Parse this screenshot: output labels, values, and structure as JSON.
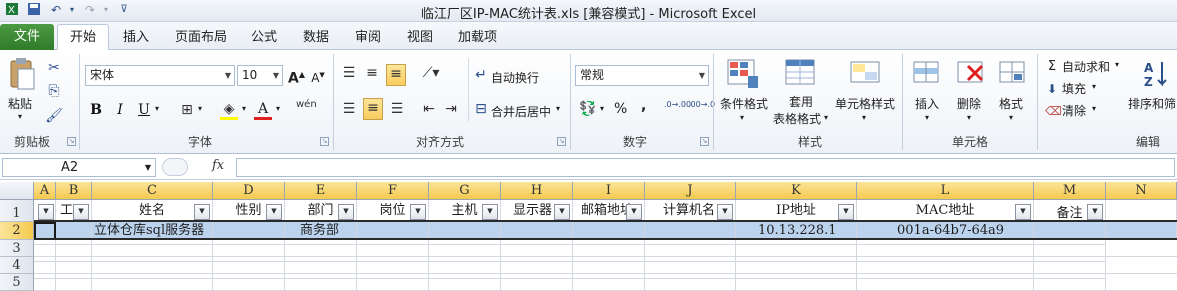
{
  "window": {
    "title": "临江厂区IP-MAC统计表.xls  [兼容模式]  -  Microsoft Excel"
  },
  "quick_access": {
    "save_icon": "save-icon",
    "undo_icon": "undo-icon",
    "redo_icon": "redo-icon",
    "customize_icon": "customize-icon"
  },
  "tabs": {
    "file": "文件",
    "home": "开始",
    "insert": "插入",
    "page_layout": "页面布局",
    "formulas": "公式",
    "data": "数据",
    "review": "审阅",
    "view": "视图",
    "addins": "加载项"
  },
  "ribbon": {
    "clipboard": {
      "paste": "粘贴",
      "group": "剪贴板"
    },
    "font": {
      "name": "宋体",
      "size": "10",
      "bold": "B",
      "italic": "I",
      "underline": "U",
      "phonetic": "wén",
      "group": "字体"
    },
    "alignment": {
      "wrap": "自动换行",
      "merge": "合并后居中",
      "group": "对齐方式"
    },
    "number": {
      "format": "常规",
      "percent": "%",
      "comma": ",",
      "inc_decimal": ".0→.00",
      "dec_decimal": ".00→.0",
      "group": "数字"
    },
    "styles": {
      "conditional": "条件格式",
      "table_line1": "套用",
      "table_line2": "表格格式",
      "cell_styles": "单元格样式",
      "group": "样式"
    },
    "cells": {
      "insert": "插入",
      "delete": "删除",
      "format": "格式",
      "group": "单元格"
    },
    "editing": {
      "autosum": "自动求和",
      "fill": "填充",
      "clear": "清除",
      "sort": "排序和筛",
      "group": "编辑"
    }
  },
  "formula_bar": {
    "name_box": "A2",
    "fx": "fx",
    "content": ""
  },
  "columns": [
    "A",
    "B",
    "C",
    "D",
    "E",
    "F",
    "G",
    "H",
    "I",
    "J",
    "K",
    "L",
    "M",
    "N"
  ],
  "rows": [
    "1",
    "2",
    "3",
    "4",
    "5"
  ],
  "header_row": [
    "",
    "工",
    "姓名",
    "性别",
    "部门",
    "岗位",
    "主机",
    "显示器",
    "邮箱地址",
    "计算机名",
    "IP地址",
    "MAC地址",
    "备注"
  ],
  "data_row": {
    "name": "立体仓库sql服务器",
    "dept": "商务部",
    "ip": "10.13.228.1",
    "mac": "001a-64b7-64a9"
  }
}
